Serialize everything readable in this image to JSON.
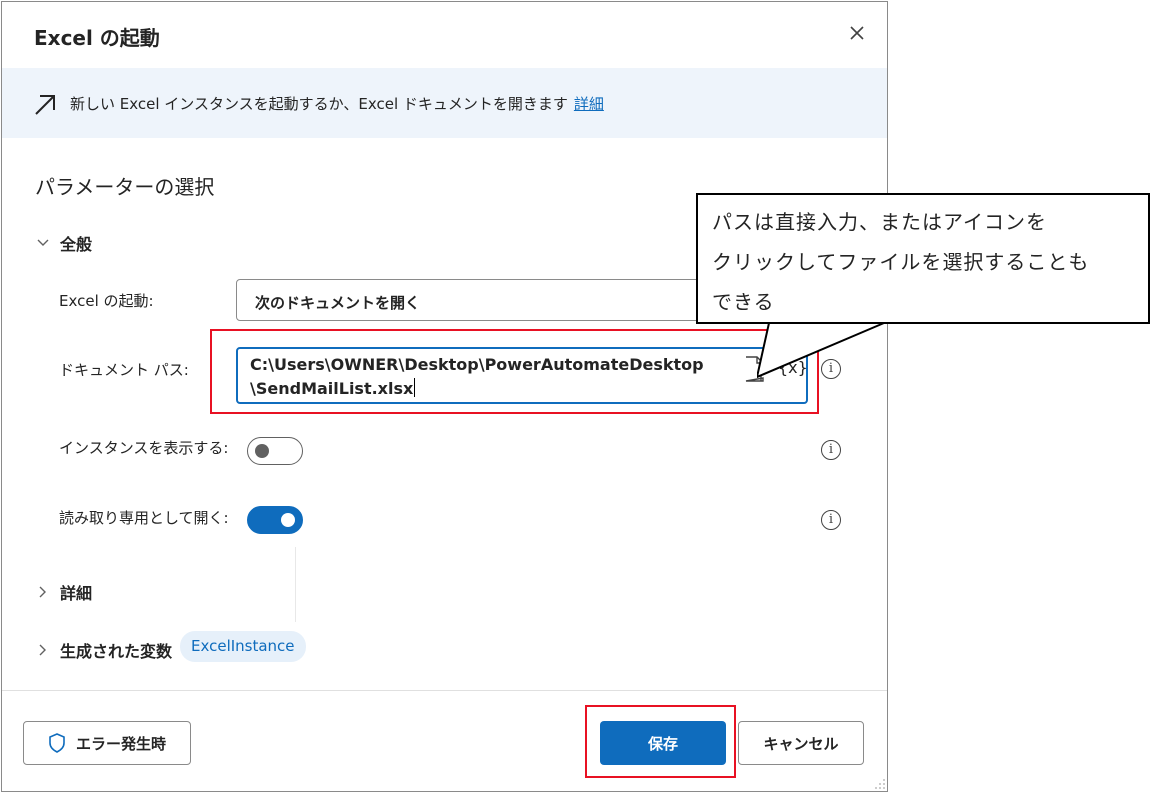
{
  "dialog": {
    "title": "Excel の起動",
    "close_icon": "close-icon",
    "info_bar": {
      "icon": "arrow-up-right-icon",
      "text": "新しい Excel インスタンスを起動するか、Excel ドキュメントを開きます",
      "link": "詳細"
    },
    "section_title": "パラメーターの選択",
    "groups": {
      "general": "全般",
      "details": "詳細",
      "generated_vars": "生成された変数"
    },
    "fields": {
      "launch_label": "Excel の起動:",
      "launch_value": "次のドキュメントを開く",
      "path_label": "ドキュメント パス:",
      "path_value_line1": "C:\\Users\\OWNER\\Desktop\\PowerAutomateDesktop",
      "path_value_line2": "\\SendMailList.xlsx",
      "path_file_icon": "file-upload-icon",
      "path_var_icon": "{x}",
      "visible_label": "インスタンスを表示する:",
      "visible_toggle": false,
      "readonly_label": "読み取り専用として開く:",
      "readonly_toggle": true
    },
    "variable_chip": "ExcelInstance",
    "footer": {
      "error_button": "エラー発生時",
      "error_icon": "shield-icon",
      "save_button": "保存",
      "cancel_button": "キャンセル"
    }
  },
  "annotation": {
    "callout_line1": "パスは直接入力、またはアイコンを",
    "callout_line2": "クリックしてファイルを選択することも",
    "callout_line3": "できる",
    "highlight_color": "#e81123"
  },
  "colors": {
    "accent": "#0f6cbd",
    "info_bar_bg": "#eef4fb",
    "chip_bg": "#e6f0fa"
  }
}
